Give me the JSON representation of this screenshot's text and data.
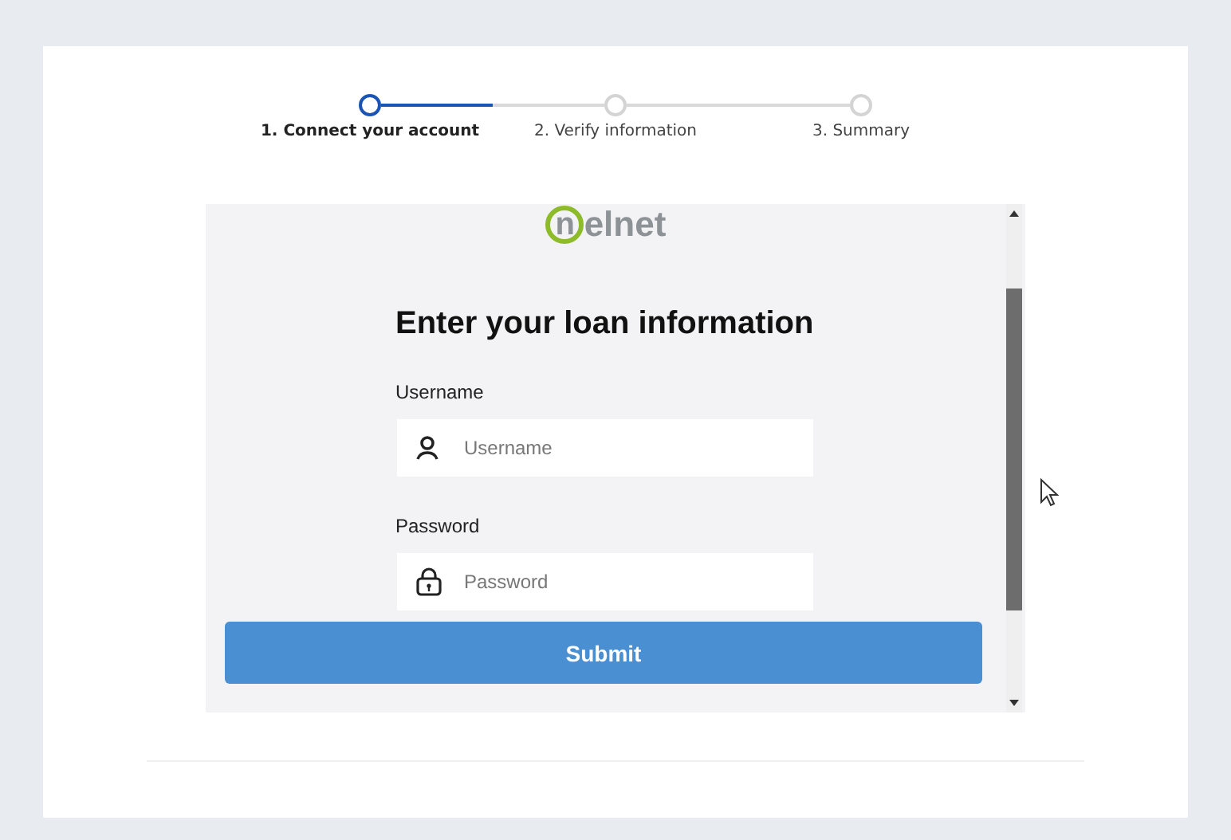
{
  "stepper": {
    "steps": [
      {
        "label": "1. Connect your account",
        "selected": true
      },
      {
        "label": "2. Verify information",
        "selected": false
      },
      {
        "label": "3. Summary",
        "selected": false
      }
    ],
    "progress": {
      "level": 0.5
    }
  },
  "login": {
    "logo": {
      "mark": "n",
      "text": "elnet"
    },
    "heading": "Enter your loan information",
    "fields": [
      {
        "kind": "user",
        "label": "Username",
        "placeholder": "Username"
      },
      {
        "kind": "lock",
        "label": "Password",
        "placeholder": "Password"
      }
    ],
    "submit": "Submit"
  }
}
